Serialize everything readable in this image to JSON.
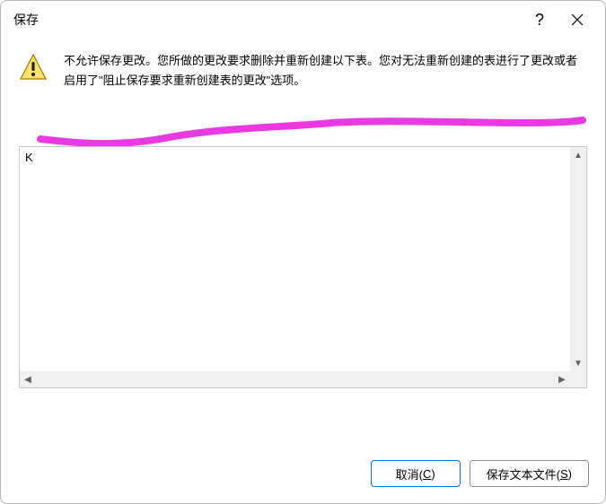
{
  "titlebar": {
    "title": "保存",
    "help": "?",
    "close": "✕"
  },
  "message": {
    "text": "不允许保存更改。您所做的更改要求删除并重新创建以下表。您对无法重新创建的表进行了更改或者启用了\"阻止保存要求重新创建表的更改\"选项。"
  },
  "list": {
    "items": [
      "K"
    ]
  },
  "buttons": {
    "cancel_pre": "取消(",
    "cancel_key": "C",
    "cancel_post": ")",
    "save_pre": "保存文本文件(",
    "save_key": "S",
    "save_post": ")"
  },
  "colors": {
    "highlight": "#e83ae0"
  }
}
